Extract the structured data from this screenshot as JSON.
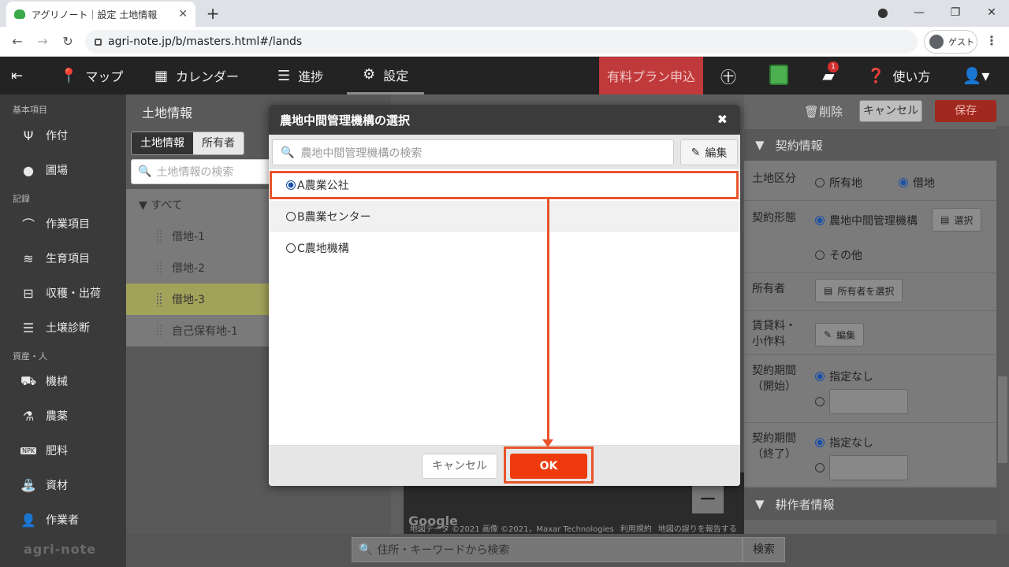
{
  "browser": {
    "tab_title": "アグリノート｜設定 土地情報",
    "tab_close": "✕",
    "new_tab": "+",
    "url": "agri-note.jp/b/masters.html#/lands",
    "guest_label": "ゲスト",
    "minimize": "—",
    "restore": "❐",
    "close": "✕"
  },
  "nav": {
    "back": "⇤",
    "map": "マップ",
    "calendar": "カレンダー",
    "progress": "進捗",
    "settings": "設定",
    "paid_plan": "有料プラン申込",
    "help": "使い方",
    "notification_count": "1"
  },
  "sidebar": {
    "section_basic": "基本項目",
    "crop": "作付",
    "field": "圃場",
    "section_record": "記録",
    "work_item": "作業項目",
    "growth_item": "生育項目",
    "harvest": "収穫・出荷",
    "soil": "土壌診断",
    "section_assets": "資産・人",
    "machine": "機械",
    "pesticide": "農薬",
    "fertilizer": "肥料",
    "material": "資材",
    "worker": "作業者",
    "logo": "agri-note"
  },
  "land_panel": {
    "title": "土地情報",
    "tab_land": "土地情報",
    "tab_owner": "所有者",
    "search_placeholder": "土地情報の検索",
    "all": "▼ すべて",
    "items": [
      "借地-1",
      "借地-2",
      "借地-3",
      "自己保有地-1"
    ]
  },
  "map": {
    "google": "Google",
    "attribution_1": "地図データ ©2021 画像 ©2021，Maxar Technologies",
    "attribution_2": "利用規約",
    "attribution_3": "地図の誤りを報告する"
  },
  "right_panel": {
    "delete": "削除",
    "cancel": "キャンセル",
    "save": "保存",
    "contract_section": "契約情報",
    "land_type_label": "土地区分",
    "land_type_owned": "所有地",
    "land_type_leased": "借地",
    "contract_form_label": "契約形態",
    "contract_form_org": "農地中間管理機構",
    "select_button": "選択",
    "contract_form_other": "その他",
    "owner_label": "所有者",
    "owner_button": "所有者を選択",
    "rent_label_1": "賃貸料・",
    "rent_label_2": "小作料",
    "rent_button": "編集",
    "period_start_label_1": "契約期間",
    "period_start_label_2": "（開始）",
    "period_end_label_1": "契約期間",
    "period_end_label_2": "（終了）",
    "unspecified": "指定なし",
    "cultivator_section": "耕作者情報"
  },
  "bottom": {
    "search_placeholder": "住所・キーワードから検索",
    "search_button": "検索"
  },
  "modal": {
    "title": "農地中間管理機構の選択",
    "search_placeholder": "農地中間管理機構の検索",
    "edit": "編集",
    "options": [
      "A農業公社",
      "B農業センター",
      "C農地機構"
    ],
    "selected_index": 0,
    "cancel": "キャンセル",
    "ok": "OK"
  },
  "colors": {
    "accent_ok": "#ef3a0e",
    "annotation": "#e8542a",
    "paid_plan": "#c0393b"
  }
}
